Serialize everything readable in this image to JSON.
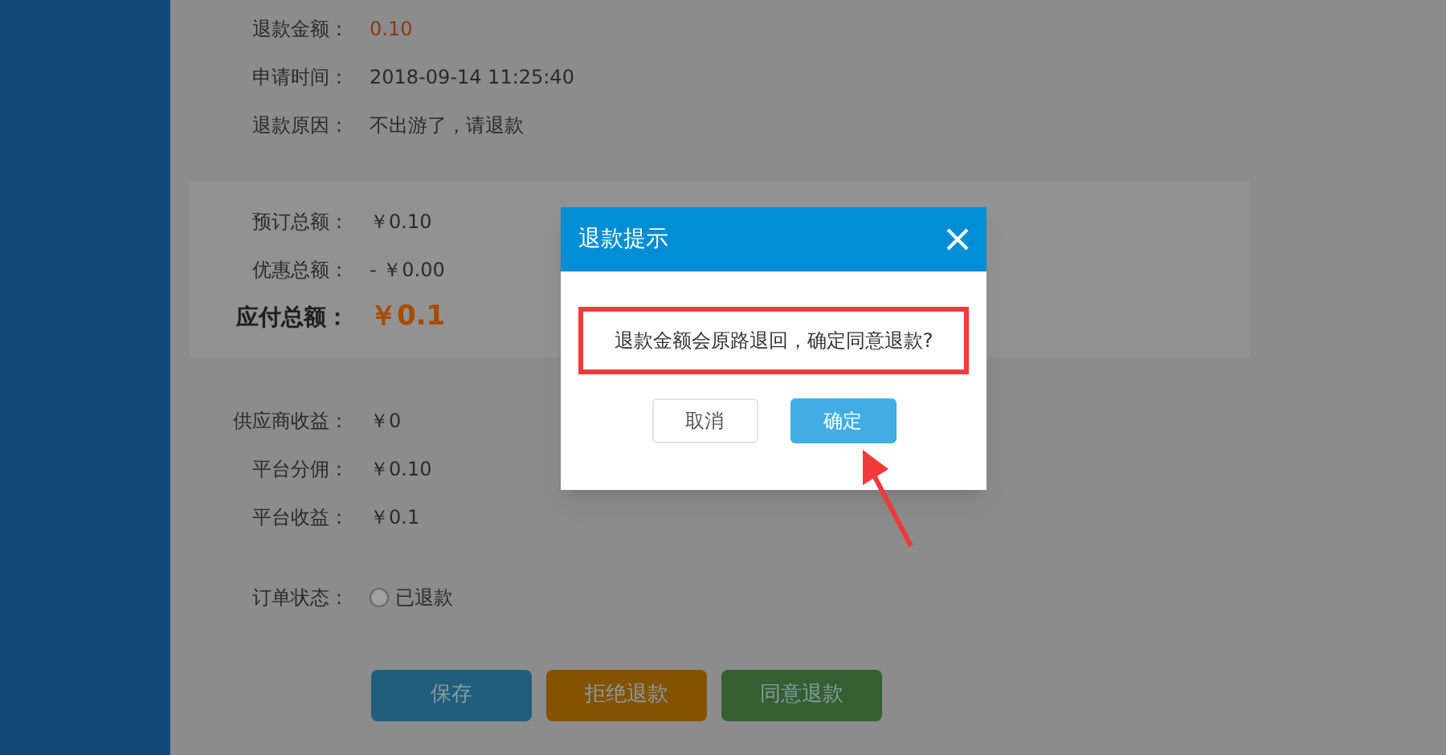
{
  "refund_info": [
    {
      "label": "退款金额：",
      "value": "0.10",
      "kind": "highlight"
    },
    {
      "label": "申请时间：",
      "value": "2018-09-14 11:25:40",
      "kind": "plain"
    },
    {
      "label": "退款原因：",
      "value": "不出游了，请退款",
      "kind": "plain"
    }
  ],
  "summary": [
    {
      "label": "预订总额：",
      "value": "￥0.10",
      "kind": "plain"
    },
    {
      "label": "优惠总额：",
      "value": "- ￥0.00",
      "kind": "plain"
    },
    {
      "label": "应付总额：",
      "value": "￥0.1",
      "kind": "total"
    }
  ],
  "earnings": [
    {
      "label": "供应商收益：",
      "value": "￥0"
    },
    {
      "label": "平台分佣：",
      "value": "￥0.10"
    },
    {
      "label": "平台收益：",
      "value": "￥0.1"
    }
  ],
  "order_status": {
    "label": "订单状态：",
    "option": "已退款",
    "checked": false
  },
  "actions": [
    {
      "label": "保存",
      "color": "#215d7c"
    },
    {
      "label": "拒绝退款",
      "color": "#845300"
    },
    {
      "label": "同意退款",
      "color": "#335f33"
    }
  ],
  "dialog": {
    "title": "退款提示",
    "message": "退款金额会原路退回，确定同意退款?",
    "buttons": [
      {
        "label": "取消",
        "kind": "secondary"
      },
      {
        "label": "确定",
        "kind": "primary"
      }
    ]
  }
}
